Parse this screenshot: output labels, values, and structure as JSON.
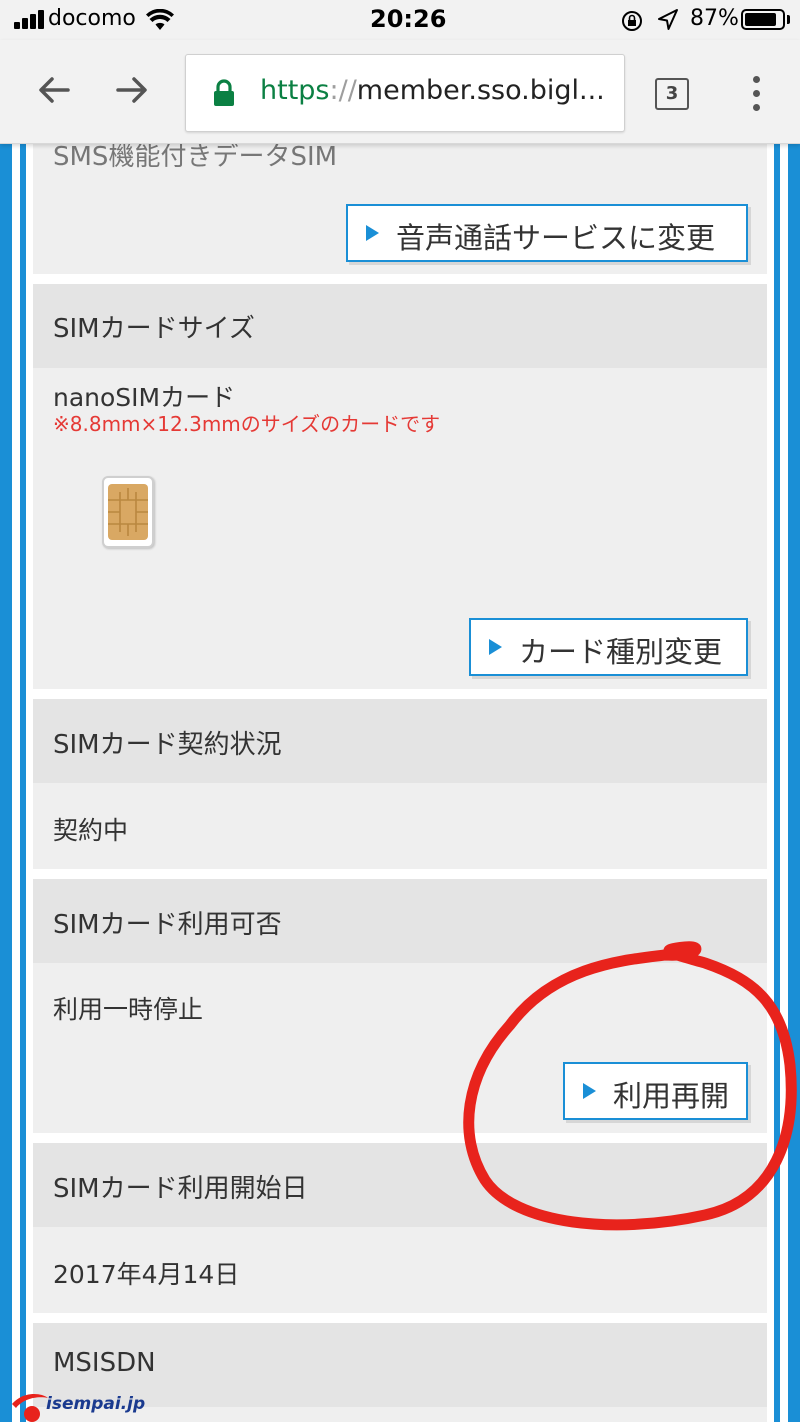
{
  "status_bar": {
    "carrier": "docomo",
    "time": "20:26",
    "battery_percent": "87%",
    "battery_level": 0.87
  },
  "browser": {
    "url_scheme": "https",
    "url_sep": "://",
    "url_rest": "member.sso.bigl...",
    "tab_count": "3"
  },
  "sections": {
    "sim_type": {
      "cut_value": "SMS機能付きデータSIM",
      "button": "音声通話サービスに変更"
    },
    "sim_size": {
      "label": "SIMカードサイズ",
      "value": "nanoSIMカード",
      "note": "※8.8mm×12.3mmのサイズのカードです",
      "button": "カード種別変更"
    },
    "contract_status": {
      "label": "SIMカード契約状況",
      "value": "契約中"
    },
    "availability": {
      "label": "SIMカード利用可否",
      "value": "利用一時停止",
      "button": "利用再開"
    },
    "start_date": {
      "label": "SIMカード利用開始日",
      "value": "2017年4月14日"
    },
    "msisdn": {
      "label": "MSISDN"
    }
  },
  "watermark": {
    "text": "isempai.jp"
  },
  "colors": {
    "accent": "#1a8fd6",
    "note_red": "#e53935",
    "annotation_red": "#e8231c",
    "secure_green": "#0b8043"
  }
}
